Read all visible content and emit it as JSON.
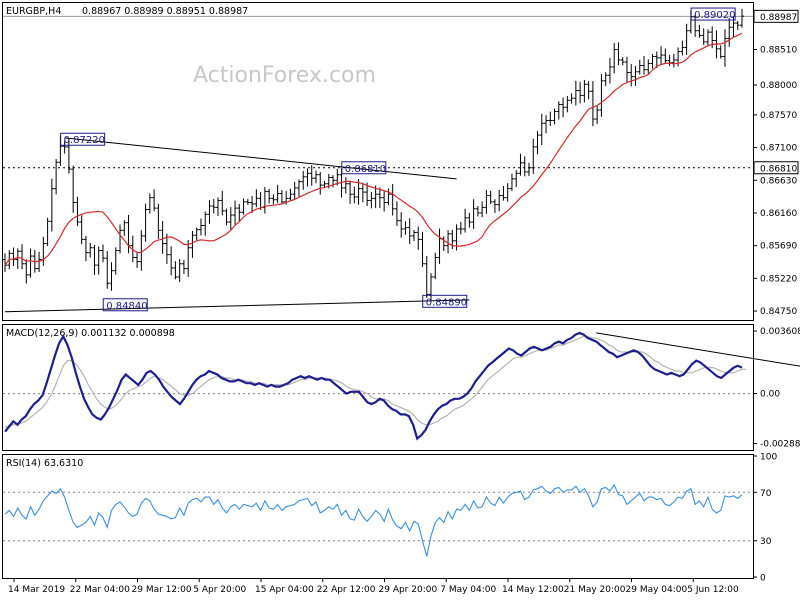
{
  "header": {
    "symbol": "EURGBP,H4",
    "ohlc": "0.88967 0.88989 0.88951 0.88987"
  },
  "watermark": "ActionForex.com",
  "colors": {
    "price": "#000000",
    "ma": "#d42a2a",
    "macd": "#1e1e8c",
    "signal": "#b4b4b4",
    "rsi": "#3b8fd9",
    "label_box": "#1a1a8c",
    "grid_dotted": "#808080"
  },
  "chart_data": [
    {
      "type": "bar",
      "name": "price",
      "title": "EURGBP,H4",
      "y_axis_ticks": [
        "0.88510",
        "0.88000",
        "0.87570",
        "0.87100",
        "0.86630",
        "0.86160",
        "0.85690",
        "0.85220",
        "0.84750"
      ],
      "ylim": [
        0.8465,
        0.8915
      ],
      "current_price_label": "0.88987",
      "current_price": 0.88987,
      "horizontal_level": {
        "label": "0.86810",
        "value": 0.8681,
        "style": "dotted"
      },
      "annotations": [
        {
          "label": "0.87220",
          "value": 0.8722,
          "bar": 14
        },
        {
          "label": "0.84840",
          "value": 0.8484,
          "bar": 24
        },
        {
          "label": "0.86810",
          "value": 0.8681,
          "bar": 80
        },
        {
          "label": "0.84890",
          "value": 0.8489,
          "bar": 99
        },
        {
          "label": "0.89020",
          "value": 0.8902,
          "bar": 162
        }
      ],
      "trendlines": [
        {
          "from": {
            "bar": 14,
            "value": 0.8724
          },
          "to": {
            "bar": 106,
            "value": 0.8665
          }
        },
        {
          "from": {
            "bar": 0,
            "value": 0.8474
          },
          "to": {
            "bar": 109,
            "value": 0.8491
          }
        }
      ],
      "close": [
        0.8541,
        0.8558,
        0.8549,
        0.8561,
        0.8543,
        0.8527,
        0.8554,
        0.8536,
        0.8549,
        0.8572,
        0.8604,
        0.8651,
        0.8689,
        0.8712,
        0.8711,
        0.8679,
        0.8631,
        0.8603,
        0.8578,
        0.8559,
        0.8566,
        0.8541,
        0.8562,
        0.8551,
        0.8515,
        0.8533,
        0.8562,
        0.8591,
        0.8602,
        0.8569,
        0.8552,
        0.8546,
        0.8583,
        0.8621,
        0.8638,
        0.8623,
        0.8591,
        0.8572,
        0.8556,
        0.8537,
        0.8524,
        0.8543,
        0.8536,
        0.8566,
        0.8584,
        0.8592,
        0.8598,
        0.8614,
        0.8626,
        0.8624,
        0.8634,
        0.8619,
        0.8603,
        0.8613,
        0.8623,
        0.8617,
        0.8632,
        0.8631,
        0.8629,
        0.8637,
        0.8624,
        0.8647,
        0.8637,
        0.8635,
        0.8644,
        0.8632,
        0.8637,
        0.8643,
        0.8652,
        0.8661,
        0.8668,
        0.8673,
        0.8666,
        0.8671,
        0.8656,
        0.8658,
        0.8667,
        0.8663,
        0.8671,
        0.8652,
        0.8658,
        0.8643,
        0.8639,
        0.8651,
        0.8646,
        0.8634,
        0.8637,
        0.8643,
        0.8638,
        0.8631,
        0.8643,
        0.8622,
        0.8605,
        0.8593,
        0.8595,
        0.8583,
        0.8588,
        0.8578,
        0.8543,
        0.8499,
        0.8524,
        0.8552,
        0.8579,
        0.8569,
        0.8586,
        0.8576,
        0.8593,
        0.8593,
        0.8609,
        0.8603,
        0.8622,
        0.8616,
        0.8624,
        0.8641,
        0.8632,
        0.8628,
        0.8641,
        0.8638,
        0.8651,
        0.8665,
        0.8673,
        0.8688,
        0.8675,
        0.8681,
        0.8711,
        0.8728,
        0.8745,
        0.8749,
        0.8749,
        0.8762,
        0.8772,
        0.8768,
        0.8778,
        0.8781,
        0.8792,
        0.8785,
        0.8801,
        0.8791,
        0.8751,
        0.8764,
        0.8806,
        0.8814,
        0.8826,
        0.8851,
        0.8836,
        0.8833,
        0.8818,
        0.8812,
        0.8819,
        0.8828,
        0.8822,
        0.8831,
        0.8841,
        0.8839,
        0.8843,
        0.8835,
        0.8832,
        0.8836,
        0.8848,
        0.8854,
        0.8878,
        0.8898,
        0.8878,
        0.8871,
        0.8862,
        0.8876,
        0.8864,
        0.8852,
        0.8841,
        0.8867,
        0.8883,
        0.8889,
        0.8886,
        0.8899
      ]
    },
    {
      "type": "line",
      "name": "macd",
      "title": "MACD(12,26,9) 0.001132 0.000898",
      "y_axis_ticks": [
        "0.003608",
        "0.00",
        "-0.002886"
      ],
      "ylim": [
        -0.0032,
        0.0039
      ],
      "series": [
        {
          "name": "MACD",
          "values": [
            -0.0022,
            -0.0019,
            -0.0016,
            -0.0018,
            -0.0015,
            -0.0013,
            -0.0009,
            -0.0006,
            -0.0004,
            -0.0001,
            0.0006,
            0.0014,
            0.0022,
            0.0029,
            0.0033,
            0.0028,
            0.0021,
            0.0012,
            0.0004,
            -0.0003,
            -0.0008,
            -0.0012,
            -0.0014,
            -0.0015,
            -0.0012,
            -0.0008,
            -0.0003,
            0.0002,
            0.0008,
            0.0011,
            0.0009,
            0.0007,
            0.0005,
            0.0008,
            0.0012,
            0.0013,
            0.0011,
            0.0008,
            0.0004,
            0.0001,
            -0.0002,
            -0.0004,
            -0.0006,
            -0.0003,
            0.0001,
            0.0005,
            0.0008,
            0.001,
            0.0011,
            0.0013,
            0.0012,
            0.0011,
            0.0009,
            0.0008,
            0.0007,
            0.0007,
            0.0008,
            0.0007,
            0.0006,
            0.0006,
            0.0005,
            0.0006,
            0.0005,
            0.0004,
            0.0005,
            0.0004,
            0.0004,
            0.0005,
            0.0006,
            0.0008,
            0.0009,
            0.001,
            0.0009,
            0.001,
            0.0009,
            0.0008,
            0.0009,
            0.0008,
            0.0008,
            0.0006,
            0.0004,
            0.0002,
            0.0,
            0.0001,
            0.0001,
            0.0001,
            -0.0002,
            -0.0005,
            -0.0006,
            -0.0005,
            -0.0003,
            -0.0004,
            -0.0007,
            -0.0009,
            -0.001,
            -0.0012,
            -0.0012,
            -0.0013,
            -0.0018,
            -0.0026,
            -0.0024,
            -0.0021,
            -0.0016,
            -0.0012,
            -0.0009,
            -0.0007,
            -0.0006,
            -0.0004,
            -0.0003,
            -0.0003,
            -0.0002,
            0.0,
            0.0003,
            0.0007,
            0.001,
            0.0013,
            0.0016,
            0.0018,
            0.002,
            0.0022,
            0.0024,
            0.0026,
            0.0025,
            0.0023,
            0.0022,
            0.0024,
            0.0026,
            0.0027,
            0.0026,
            0.0025,
            0.0026,
            0.0027,
            0.0029,
            0.003,
            0.0029,
            0.0031,
            0.0032,
            0.0034,
            0.0035,
            0.0034,
            0.0032,
            0.0031,
            0.003,
            0.0028,
            0.0026,
            0.0024,
            0.0023,
            0.0021,
            0.0022,
            0.0023,
            0.0024,
            0.0025,
            0.0024,
            0.0022,
            0.0019,
            0.0016,
            0.0014,
            0.0013,
            0.0012,
            0.0011,
            0.0012,
            0.0011,
            0.001,
            0.0011,
            0.0014,
            0.0017,
            0.0019,
            0.0018,
            0.0016,
            0.0014,
            0.0012,
            0.001,
            0.0009,
            0.0011,
            0.0013,
            0.0015,
            0.0016,
            0.0015
          ]
        },
        {
          "name": "Signal",
          "values": [
            -0.0019,
            -0.0019,
            -0.0018,
            -0.0018,
            -0.0017,
            -0.0016,
            -0.0014,
            -0.0012,
            -0.001,
            -0.0008,
            -0.0005,
            -0.0001,
            0.0004,
            0.001,
            0.0016,
            0.0019,
            0.0019,
            0.0017,
            0.0014,
            0.001,
            0.0005,
            0.0001,
            -0.0003,
            -0.0006,
            -0.0008,
            -0.0009,
            -0.0008,
            -0.0006,
            -0.0003,
            0.0,
            0.0002,
            0.0003,
            0.0004,
            0.0005,
            0.0007,
            0.0009,
            0.001,
            0.0009,
            0.0008,
            0.0006,
            0.0004,
            0.0002,
            0.0,
            -0.0001,
            -0.0001,
            0.0,
            0.0002,
            0.0004,
            0.0006,
            0.0008,
            0.0009,
            0.001,
            0.001,
            0.0009,
            0.0009,
            0.0008,
            0.0008,
            0.0008,
            0.0007,
            0.0007,
            0.0006,
            0.0006,
            0.0006,
            0.0005,
            0.0005,
            0.0005,
            0.0005,
            0.0005,
            0.0005,
            0.0006,
            0.0007,
            0.0008,
            0.0008,
            0.0009,
            0.0009,
            0.0009,
            0.0009,
            0.0009,
            0.0008,
            0.0008,
            0.0007,
            0.0006,
            0.0004,
            0.0003,
            0.0002,
            0.0002,
            0.0001,
            0.0,
            -0.0002,
            -0.0003,
            -0.0003,
            -0.0003,
            -0.0004,
            -0.0006,
            -0.0007,
            -0.0008,
            -0.0009,
            -0.001,
            -0.0012,
            -0.0015,
            -0.0017,
            -0.0018,
            -0.0018,
            -0.0017,
            -0.0016,
            -0.0014,
            -0.0013,
            -0.0011,
            -0.0009,
            -0.0008,
            -0.0007,
            -0.0005,
            -0.0003,
            -0.0001,
            0.0002,
            0.0005,
            0.0008,
            0.001,
            0.0012,
            0.0014,
            0.0016,
            0.0018,
            0.002,
            0.0021,
            0.0021,
            0.0022,
            0.0023,
            0.0024,
            0.0025,
            0.0025,
            0.0025,
            0.0026,
            0.0027,
            0.0028,
            0.0028,
            0.0029,
            0.003,
            0.0031,
            0.0032,
            0.0033,
            0.0033,
            0.0032,
            0.0032,
            0.0031,
            0.003,
            0.0028,
            0.0027,
            0.0025,
            0.0024,
            0.0024,
            0.0024,
            0.0024,
            0.0024,
            0.0024,
            0.0023,
            0.0021,
            0.0019,
            0.0018,
            0.0016,
            0.0015,
            0.0014,
            0.0013,
            0.0013,
            0.0012,
            0.0012,
            0.0012,
            0.0013,
            0.0014,
            0.0015,
            0.0015,
            0.0015,
            0.0014,
            0.0013,
            0.0012,
            0.0012,
            0.0012,
            0.0013,
            0.0014,
            0.0014
          ]
        }
      ],
      "trendline": {
        "from": {
          "bar": 142,
          "value": 0.0035
        },
        "to": {
          "bar": 193,
          "value": 0.0015
        }
      }
    },
    {
      "type": "line",
      "name": "rsi",
      "title": "RSI(14) 63.6310",
      "y_axis_ticks": [
        "100",
        "70",
        "30",
        "0"
      ],
      "ylim": [
        0,
        100
      ],
      "levels": [
        70,
        30
      ],
      "series": [
        {
          "name": "RSI",
          "values": [
            52,
            55,
            50,
            57,
            51,
            48,
            58,
            51,
            56,
            63,
            67,
            71,
            69,
            73,
            66,
            55,
            45,
            41,
            43,
            45,
            50,
            43,
            53,
            49,
            41,
            55,
            60,
            62,
            58,
            53,
            50,
            52,
            61,
            65,
            63,
            56,
            52,
            51,
            50,
            48,
            49,
            57,
            51,
            61,
            64,
            65,
            62,
            66,
            66,
            60,
            64,
            57,
            53,
            58,
            60,
            56,
            60,
            59,
            58,
            61,
            55,
            63,
            57,
            56,
            60,
            55,
            58,
            59,
            60,
            63,
            64,
            65,
            59,
            62,
            53,
            55,
            58,
            56,
            60,
            51,
            55,
            48,
            47,
            56,
            50,
            46,
            50,
            55,
            52,
            46,
            56,
            47,
            42,
            40,
            45,
            38,
            46,
            44,
            30,
            17,
            34,
            45,
            49,
            45,
            54,
            48,
            56,
            55,
            60,
            55,
            63,
            57,
            58,
            66,
            61,
            59,
            66,
            61,
            66,
            69,
            70,
            71,
            64,
            66,
            72,
            73,
            75,
            71,
            69,
            73,
            74,
            70,
            72,
            72,
            75,
            70,
            73,
            67,
            58,
            62,
            73,
            74,
            71,
            76,
            68,
            67,
            60,
            63,
            66,
            69,
            63,
            66,
            66,
            64,
            65,
            60,
            59,
            62,
            66,
            65,
            71,
            73,
            60,
            63,
            58,
            66,
            56,
            53,
            55,
            67,
            66,
            67,
            65,
            68
          ]
        }
      ]
    }
  ],
  "x_axis_labels": [
    "14 Mar 2019",
    "22 Mar 04:00",
    "29 Mar 12:00",
    "5 Apr 20:00",
    "15 Apr 04:00",
    "22 Apr 12:00",
    "29 Apr 20:00",
    "7 May 04:00",
    "14 May 12:00",
    "21 May 20:00",
    "29 May 04:00",
    "5 Jun 12:00"
  ]
}
